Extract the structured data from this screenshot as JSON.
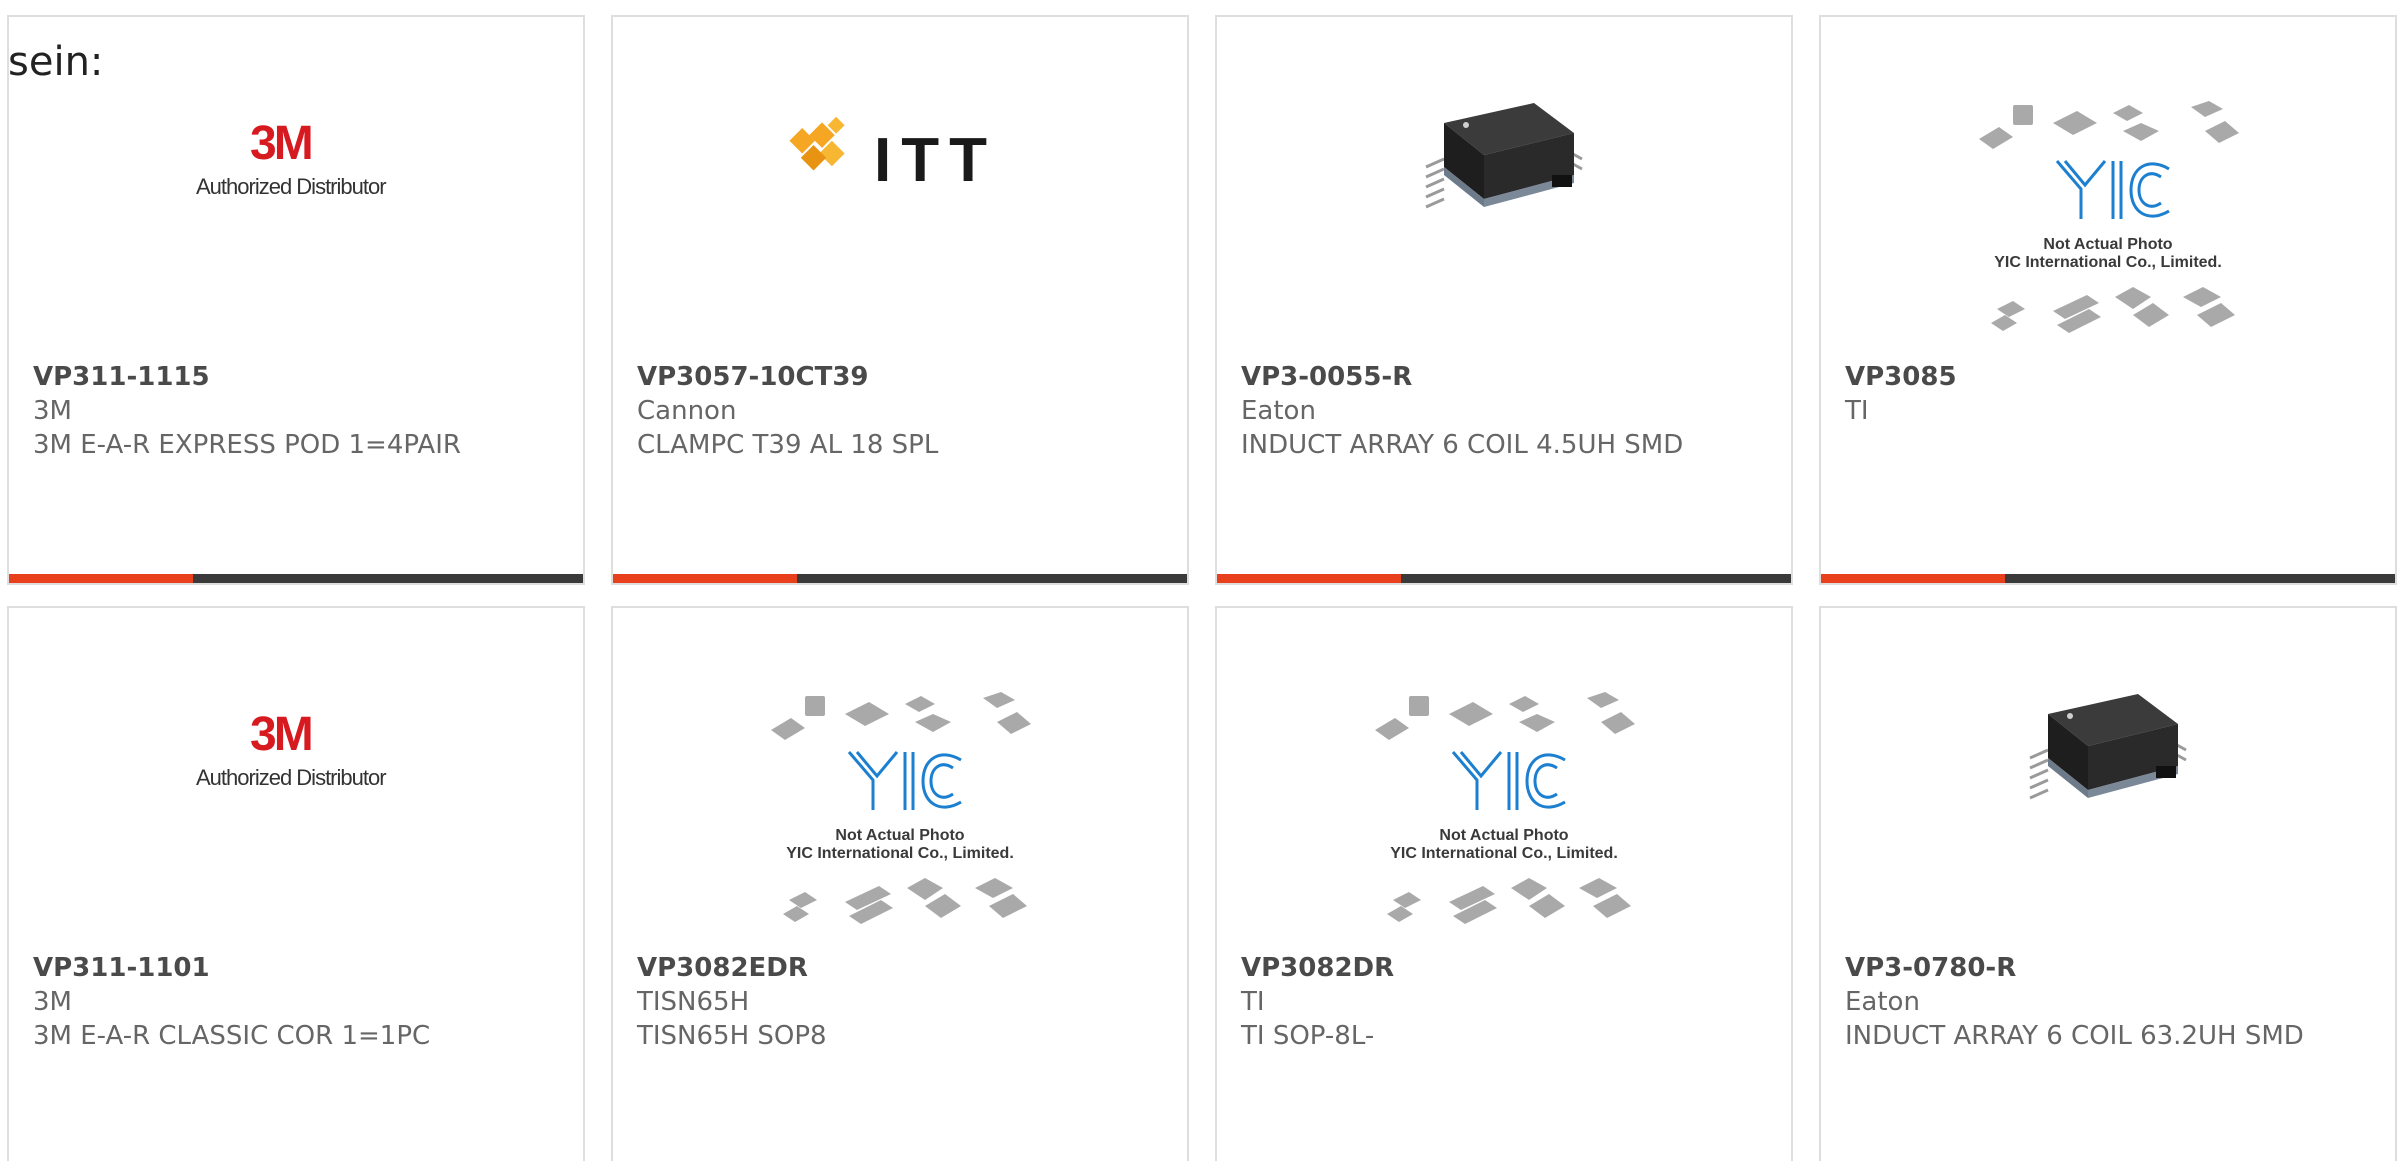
{
  "intro": "sein:",
  "colors": {
    "accent": "#e8401c",
    "track": "#3a3a3a",
    "border": "#dedede",
    "part_text": "#4a4a4a",
    "meta_text": "#666666"
  },
  "cards": [
    {
      "part_no": "VP311-1115",
      "maker": "3M",
      "description": "3M E-A-R EXPRESS POD 1=4PAIR",
      "image": "3m-authorized-distributor-logo",
      "logo_mark": "3M",
      "logo_caption": "Authorized Distributor",
      "progress": 0.32
    },
    {
      "part_no": "VP3057-10CT39",
      "maker": "Cannon",
      "description": "CLAMPC T39 AL 18 SPL",
      "image": "itt-logo",
      "logo_mark": "ITT",
      "progress": 0.32
    },
    {
      "part_no": "VP3-0055-R",
      "maker": "Eaton",
      "description": "INDUCT ARRAY 6 COIL 4.5UH SMD",
      "image": "smd-inductor-photo",
      "progress": 0.32
    },
    {
      "part_no": "VP3085",
      "maker": "TI",
      "description": "",
      "image": "yic-placeholder",
      "logo_mark": "YIC",
      "logo_caption_1": "Not Actual Photo",
      "logo_caption_2": "YIC International Co., Limited.",
      "progress": 0.32
    },
    {
      "part_no": "VP311-1101",
      "maker": "3M",
      "description": "3M E-A-R CLASSIC COR 1=1PC",
      "image": "3m-authorized-distributor-logo",
      "logo_mark": "3M",
      "logo_caption": "Authorized Distributor",
      "progress": 0.32
    },
    {
      "part_no": "VP3082EDR",
      "maker": "TISN65H",
      "description": "TISN65H SOP8",
      "image": "yic-placeholder",
      "logo_mark": "YIC",
      "logo_caption_1": "Not Actual Photo",
      "logo_caption_2": "YIC International Co., Limited.",
      "progress": 0.32
    },
    {
      "part_no": "VP3082DR",
      "maker": "TI",
      "description": "TI SOP-8L-",
      "image": "yic-placeholder",
      "logo_mark": "YIC",
      "logo_caption_1": "Not Actual Photo",
      "logo_caption_2": "YIC International Co., Limited.",
      "progress": 0.32
    },
    {
      "part_no": "VP3-0780-R",
      "maker": "Eaton",
      "description": "INDUCT ARRAY 6 COIL 63.2UH SMD",
      "image": "smd-inductor-photo",
      "progress": 0.32
    }
  ]
}
